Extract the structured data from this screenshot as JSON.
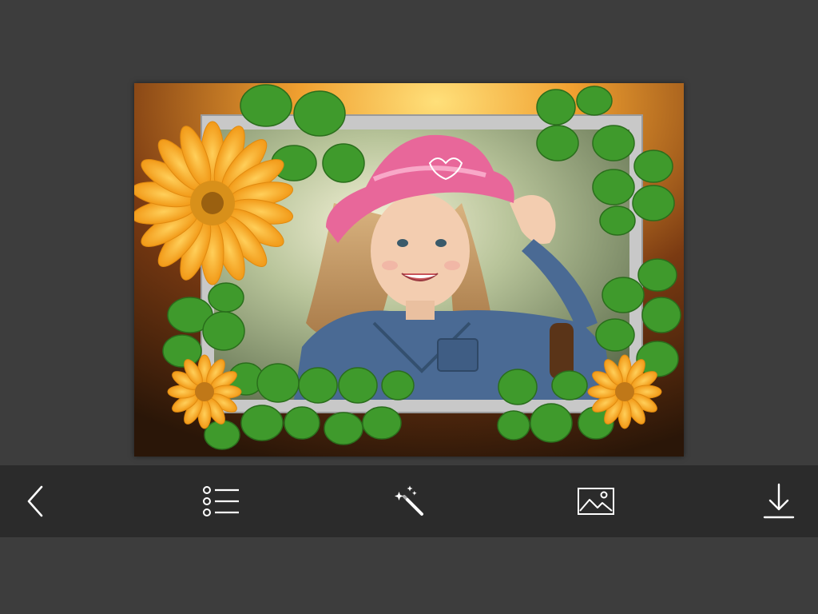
{
  "colors": {
    "background": "#3d3d3d",
    "toolbar": "#2b2b2b",
    "icon": "#ffffff",
    "frame_border": "#c9c9c9",
    "flower_petal": "#f5a623",
    "flower_center": "#b06a10",
    "leaf": "#3f9a2c",
    "hat": "#e8679a",
    "shirt": "#4a6a94"
  },
  "preview": {
    "frame_theme": "sunflower-vine-frame",
    "photo_subject": "girl-in-pink-hat"
  },
  "toolbar": {
    "buttons": [
      {
        "name": "back-button",
        "icon": "chevron-left-icon"
      },
      {
        "name": "frames-list-button",
        "icon": "list-icon"
      },
      {
        "name": "effects-button",
        "icon": "magic-wand-icon"
      },
      {
        "name": "gallery-button",
        "icon": "image-icon"
      },
      {
        "name": "download-button",
        "icon": "download-icon"
      }
    ]
  }
}
